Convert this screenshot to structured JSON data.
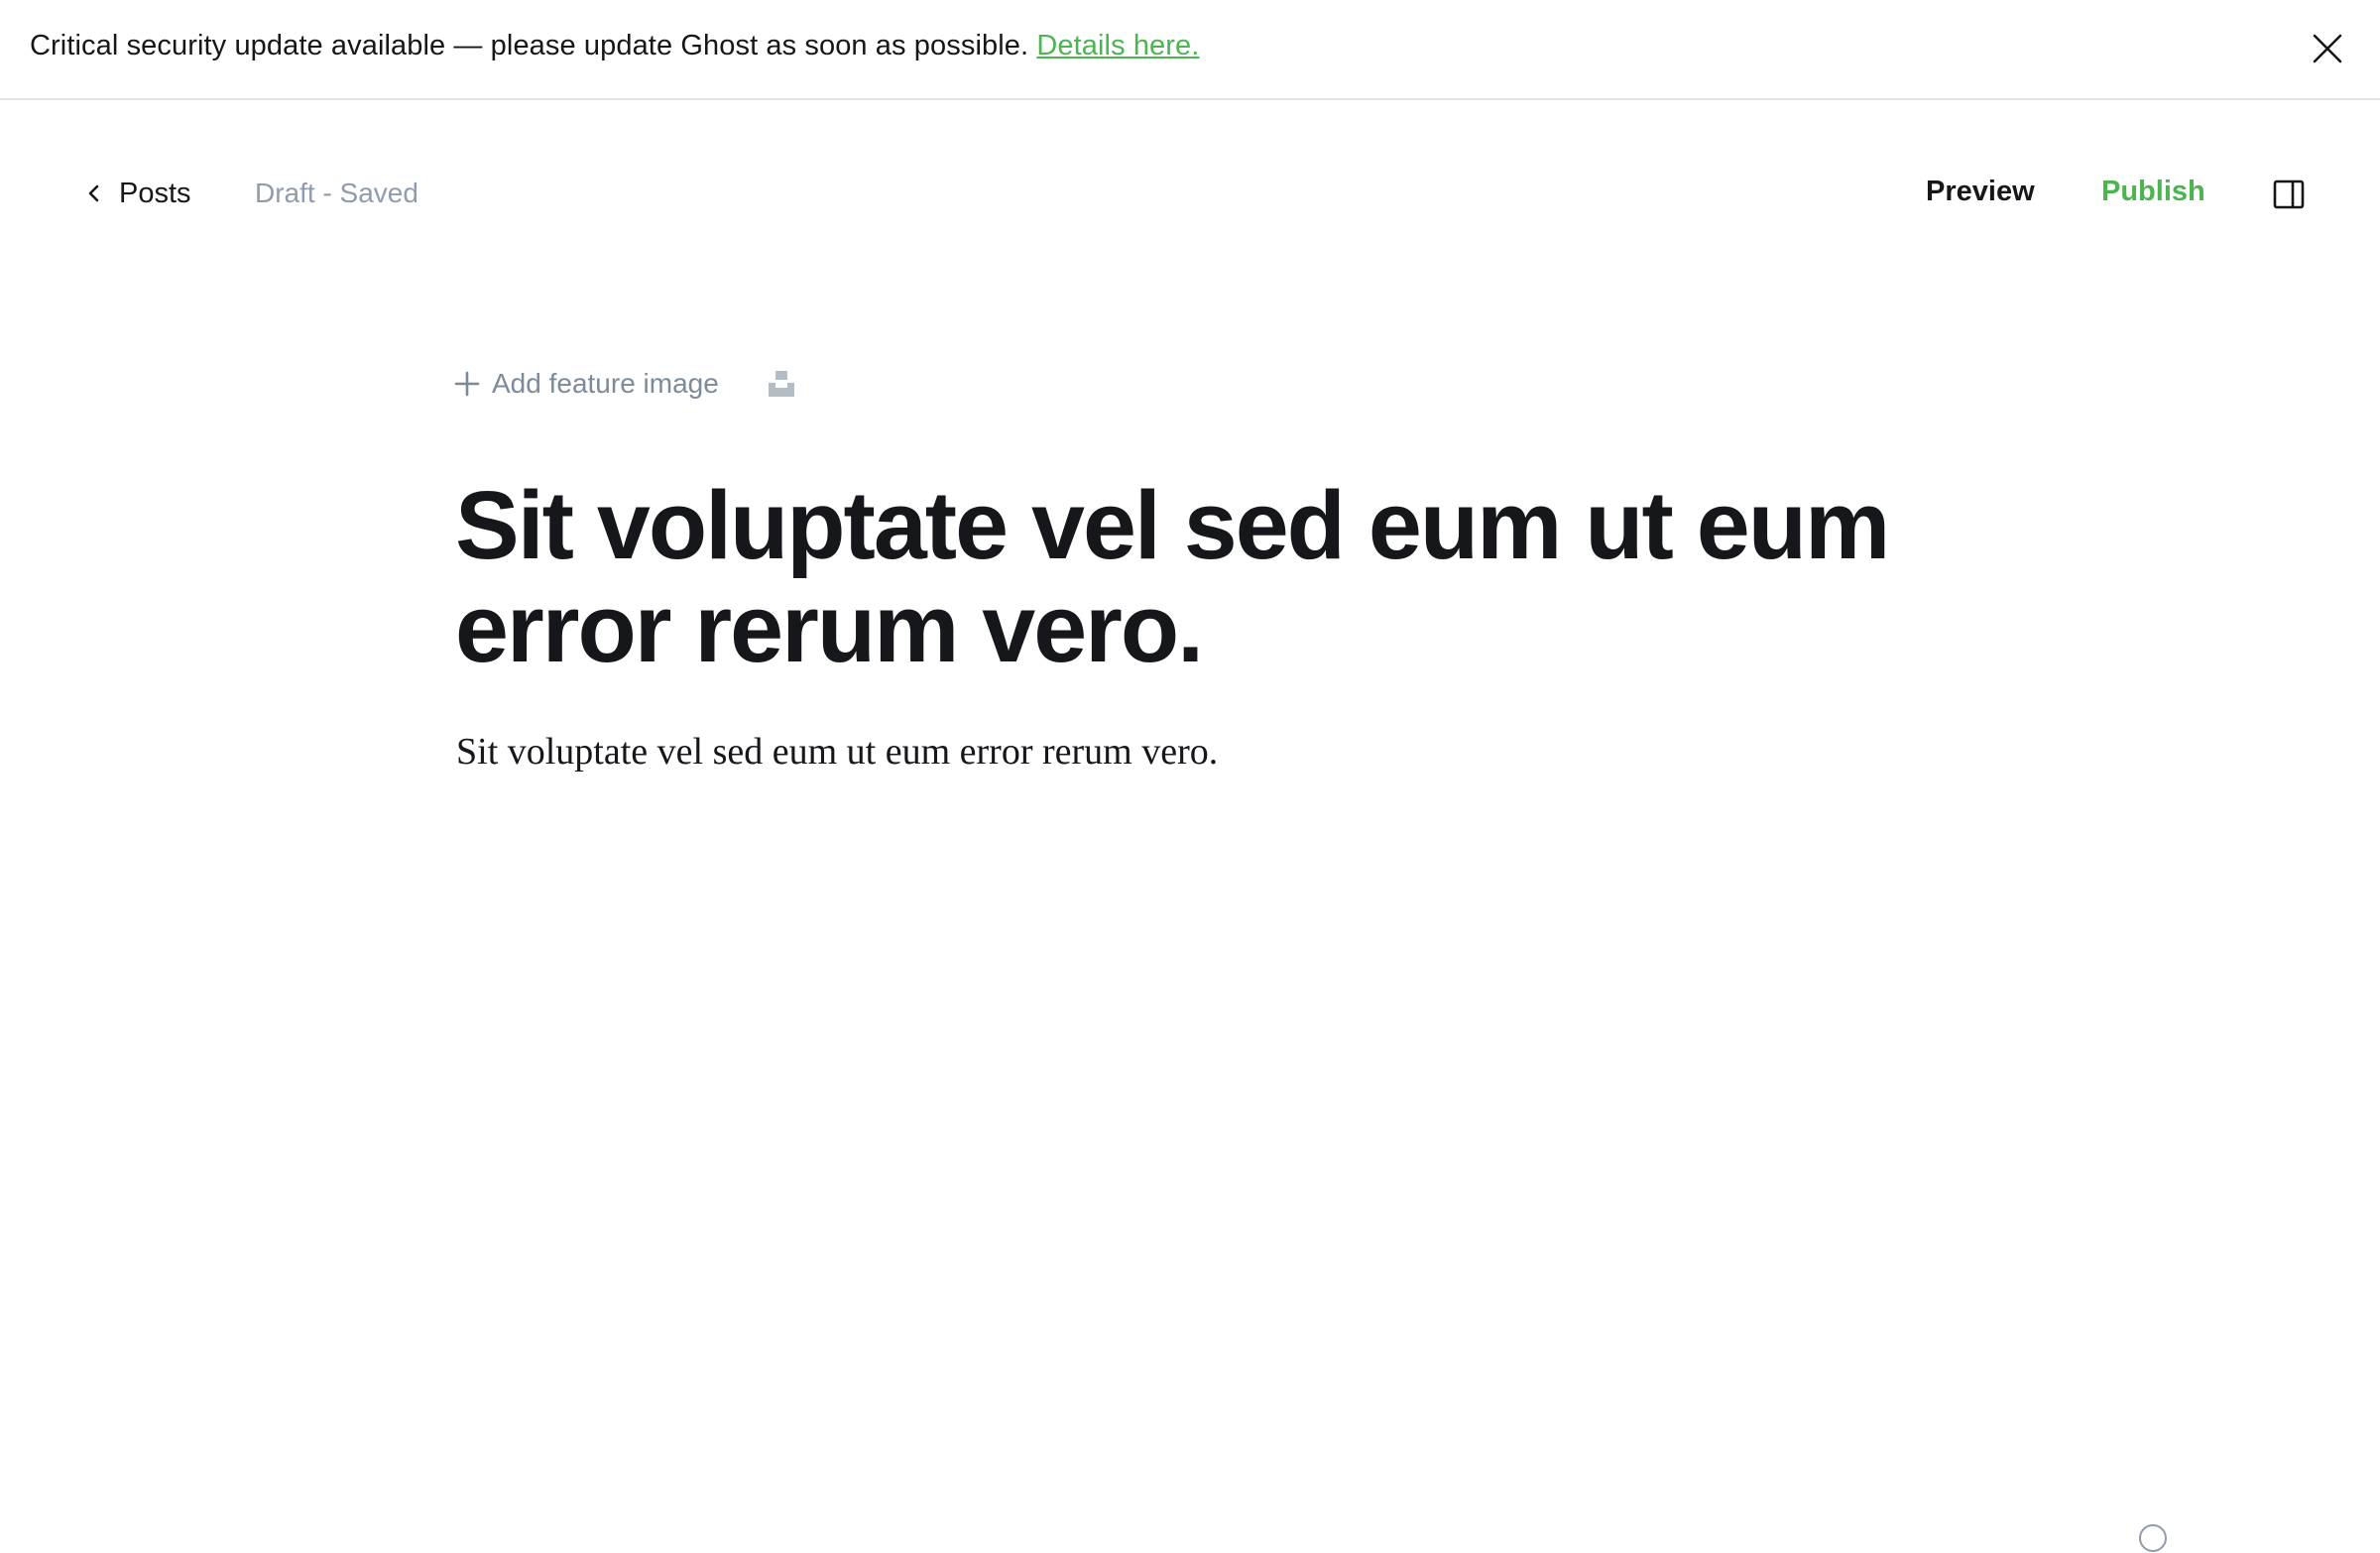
{
  "banner": {
    "message": "Critical security update available — please update Ghost as soon as possible.",
    "link_text": "Details here.",
    "close_icon": "close-icon"
  },
  "header": {
    "back_label": "Posts",
    "back_icon": "chevron-left-icon",
    "status": "Draft - Saved",
    "preview_label": "Preview",
    "publish_label": "Publish",
    "sidebar_icon": "sidebar-toggle-icon"
  },
  "editor": {
    "add_feature_image_label": "Add feature image",
    "add_icon": "plus-icon",
    "unsplash_icon": "unsplash-icon",
    "title": "Sit voluptate vel sed eum ut eum error rerum vero.",
    "body": "Sit voluptate vel sed eum ut eum error rerum vero."
  },
  "footer": {
    "help_icon": "help-icon"
  },
  "colors": {
    "accent_green": "#4cb450",
    "muted_text": "#8e9cac",
    "primary_text": "#15171a",
    "border": "#e3e6e9"
  }
}
